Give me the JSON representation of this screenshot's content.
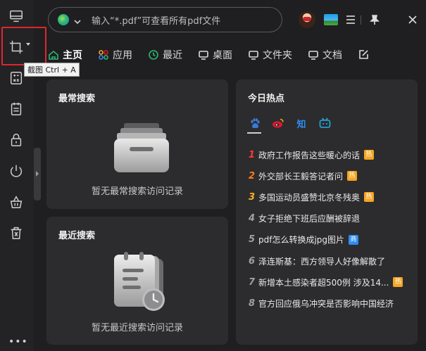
{
  "search": {
    "text": "输入“*.pdf”可查看所有pdf文件"
  },
  "tooltip": {
    "text": "截图 Ctrl + A"
  },
  "sidebar": {
    "more": "•••"
  },
  "tabs": [
    {
      "label": "主页",
      "icon": "home-icon",
      "active": true
    },
    {
      "label": "应用",
      "icon": "apps-icon"
    },
    {
      "label": "最近",
      "icon": "clock-icon"
    },
    {
      "label": "桌面",
      "icon": "desktop-icon"
    },
    {
      "label": "文件夹",
      "icon": "folder-icon"
    },
    {
      "label": "文档",
      "icon": "document-icon"
    }
  ],
  "frequent": {
    "title": "最常搜索",
    "empty": "暂无最常搜索访问记录"
  },
  "recent": {
    "title": "最近搜索",
    "empty": "暂无最近搜索访问记录"
  },
  "hot": {
    "title": "今日热点",
    "sources": [
      {
        "icon": "baidu-paw-icon",
        "color": "#3a7bd5"
      },
      {
        "icon": "weibo-icon",
        "color": "#e6162d"
      },
      {
        "label": "知",
        "color": "#2d8cf0"
      },
      {
        "icon": "bilibili-tv-icon",
        "color": "#23ade5"
      }
    ],
    "items": [
      {
        "rank": "1",
        "text": "政府工作报告这些暖心的话",
        "badge": "热"
      },
      {
        "rank": "2",
        "text": "外交部长王毅答记者问",
        "badge": "热"
      },
      {
        "rank": "3",
        "text": "多国运动员盛赞北京冬残奥",
        "badge": "热"
      },
      {
        "rank": "4",
        "text": "女子拒绝下班后应酬被辞退",
        "badge": ""
      },
      {
        "rank": "5",
        "text": "pdf怎么转换成jpg图片",
        "badge": "商"
      },
      {
        "rank": "6",
        "text": "泽连斯基：西方领导人好像解散了",
        "badge": ""
      },
      {
        "rank": "7",
        "text": "新增本土感染者超500例 涉及14...",
        "badge": "热"
      },
      {
        "rank": "8",
        "text": "官方回应俄乌冲突是否影响中国经济",
        "badge": ""
      }
    ]
  }
}
